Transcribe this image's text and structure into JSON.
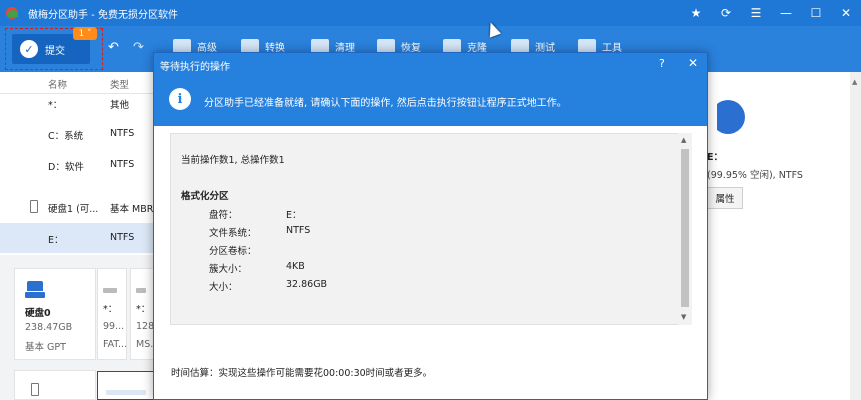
{
  "window": {
    "title": "傲梅分区助手 - 免费无损分区软件",
    "controls": {
      "star": "★",
      "refresh": "⟳",
      "menu": "☰",
      "minimize": "—",
      "maximize": "☐",
      "close": "✕"
    }
  },
  "toolbar": {
    "commit_label": "提交",
    "commit_badge": "1",
    "commit_check": "✓",
    "undo": "↶",
    "redo": "↷",
    "tools": [
      {
        "label": "高级",
        "icon": "toolbox-icon"
      },
      {
        "label": "转换",
        "icon": "convert-icon"
      },
      {
        "label": "清理",
        "icon": "clean-icon"
      },
      {
        "label": "恢复",
        "icon": "recover-icon"
      },
      {
        "label": "克隆",
        "icon": "clone-icon"
      },
      {
        "label": "测试",
        "icon": "test-icon"
      },
      {
        "label": "工具",
        "icon": "tools-icon"
      }
    ]
  },
  "partition_list": {
    "headers": {
      "name": "名称",
      "type": "类型"
    },
    "rows": [
      {
        "name": "*：",
        "type": "其他"
      },
      {
        "name": "C：系统",
        "type": "NTFS"
      },
      {
        "name": "D：软件",
        "type": "NTFS"
      },
      {
        "name": "硬盘1 (可...",
        "type": "基本 MBR"
      },
      {
        "name": "E：",
        "type": "NTFS"
      }
    ]
  },
  "disk_cards": {
    "disk0": {
      "name": "硬盘0",
      "size": "238.47GB",
      "type": "基本 GPT"
    },
    "part1": {
      "line1": "*：",
      "line2": "99...",
      "line3": "FAT..."
    },
    "part2": {
      "line1": "*：",
      "line2": "128",
      "line3": "MS..."
    }
  },
  "right_panel": {
    "label": "E：",
    "detail": "(99.95% 空闲), NTFS",
    "properties_button": "属性"
  },
  "dialog": {
    "title": "等待执行的操作",
    "help": "?",
    "close": "✕",
    "banner_icon": "i",
    "banner_message": "分区助手已经准备就绪, 请确认下面的操作, 然后点击执行按钮让程序正式地工作。",
    "ops_summary": "当前操作数1, 总操作数1",
    "op_title": "格式化分区",
    "op_fields": [
      {
        "label": "盘符：",
        "value": "E："
      },
      {
        "label": "文件系统：",
        "value": "NTFS"
      },
      {
        "label": "分区卷标：",
        "value": ""
      },
      {
        "label": "簇大小：",
        "value": "4KB"
      },
      {
        "label": "大小：",
        "value": "32.86GB"
      }
    ],
    "time_estimate": "时间估算：实现这些操作可能需要花00:00:30时间或者更多。"
  },
  "colors": {
    "titlebar": "#1f78d6",
    "toolbar": "#2a82dd",
    "commit_button": "#1565c0",
    "badge": "#ff8c1a",
    "highlight_border": "#d32020"
  }
}
